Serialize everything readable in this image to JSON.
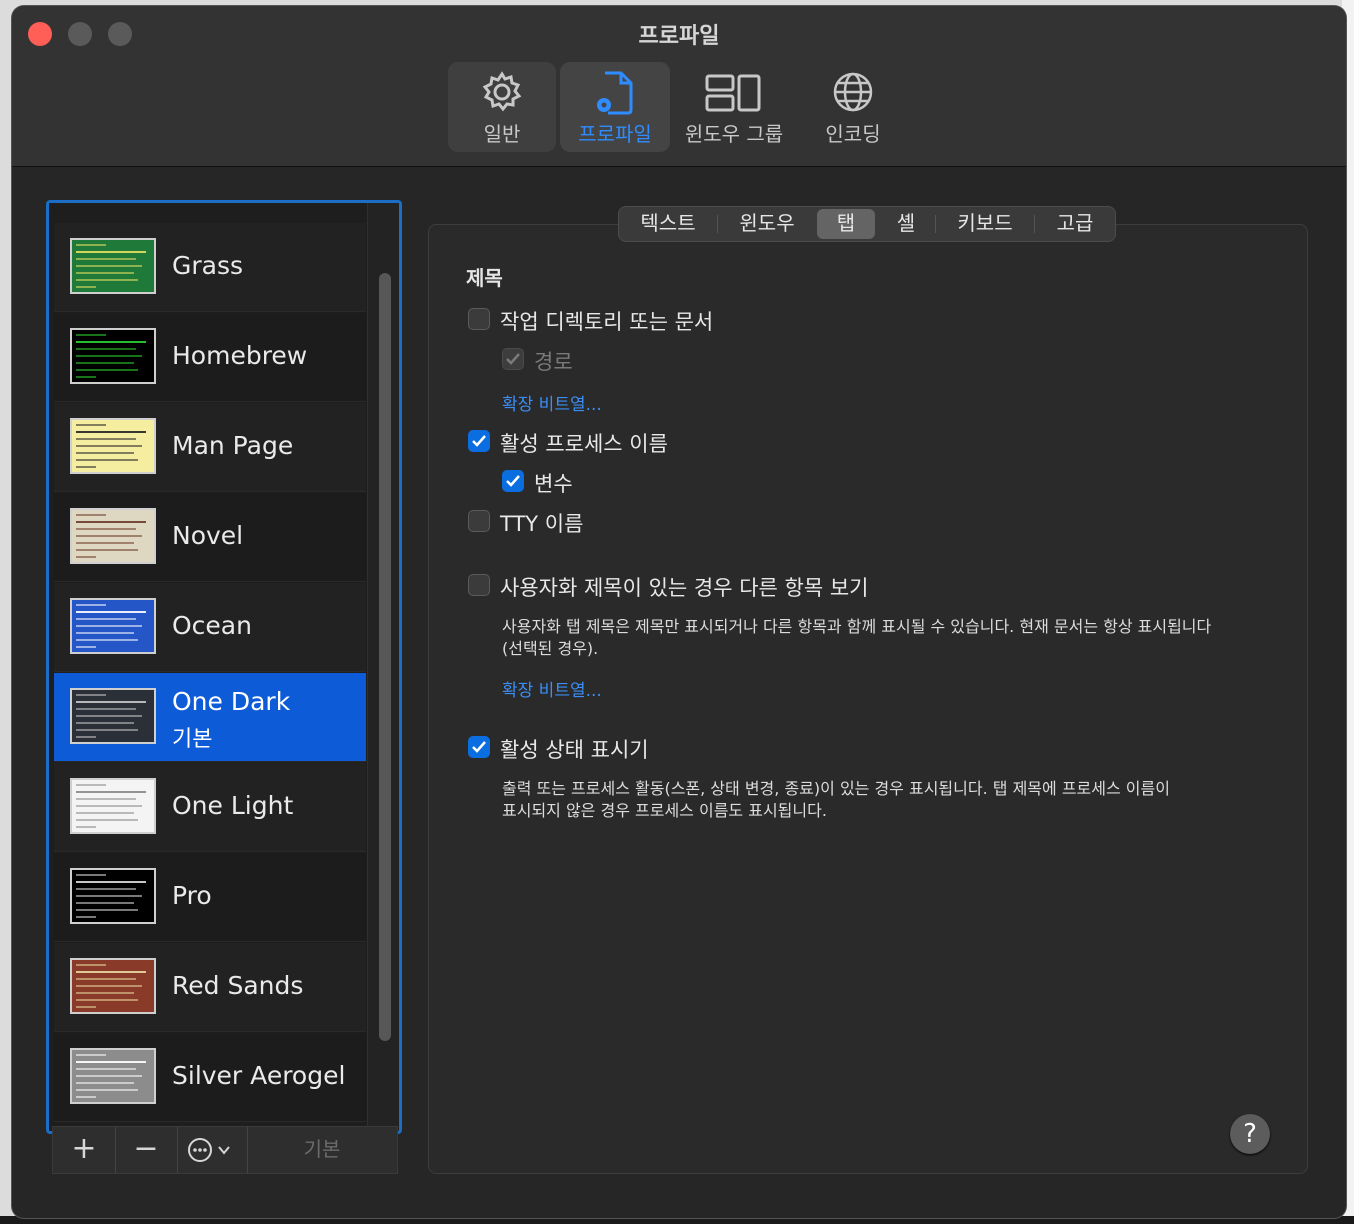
{
  "window": {
    "title": "프로파일"
  },
  "toolbar": {
    "general": "일반",
    "profiles": "프로파일",
    "window_groups": "윈도우 그룹",
    "encoding": "인코딩"
  },
  "profiles": [
    {
      "name": "Grass",
      "thumb_bg": "#1f7a3a",
      "thumb_accent": "#e8e060"
    },
    {
      "name": "Homebrew",
      "thumb_bg": "#000000",
      "thumb_accent": "#2bd42b"
    },
    {
      "name": "Man Page",
      "thumb_bg": "#f5eea0",
      "thumb_accent": "#222222"
    },
    {
      "name": "Novel",
      "thumb_bg": "#ded8c2",
      "thumb_accent": "#6b3b2a"
    },
    {
      "name": "Ocean",
      "thumb_bg": "#2456c8",
      "thumb_accent": "#ffffff"
    },
    {
      "name": "One Dark",
      "subtitle": "기본",
      "thumb_bg": "#2b2f38",
      "thumb_accent": "#c8c8c8",
      "selected": true
    },
    {
      "name": "One Light",
      "thumb_bg": "#f4f4f4",
      "thumb_accent": "#888888"
    },
    {
      "name": "Pro",
      "thumb_bg": "#000000",
      "thumb_accent": "#dddddd"
    },
    {
      "name": "Red Sands",
      "thumb_bg": "#8a3a28",
      "thumb_accent": "#e8d8a0"
    },
    {
      "name": "Silver Aerogel",
      "thumb_bg": "#8c8c8c",
      "thumb_accent": "#ffffff"
    }
  ],
  "list_buttons": {
    "add": "+",
    "remove": "−",
    "more": "⋯⌄",
    "default": "기본"
  },
  "tabs": [
    "텍스트",
    "윈도우",
    "탭",
    "셸",
    "키보드",
    "고급"
  ],
  "active_tab": "탭",
  "section": {
    "title": "제목",
    "working_dir": "작업 디렉토리 또는 문서",
    "path": "경로",
    "ext_link_1": "확장 비트열...",
    "active_process": "활성 프로세스 이름",
    "arguments": "변수",
    "tty": "TTY 이름",
    "custom_title": "사용자화 제목이 있는 경우 다른 항목 보기",
    "custom_desc_1": "사용자화 탭 제목은 제목만 표시되거나 다른 항목과 함께 표시될 수 있습니다. 현재 문서는 항상 표시됩니다",
    "custom_desc_2": "(선택된 경우).",
    "ext_link_2": "확장 비트열...",
    "activity": "활성 상태 표시기",
    "activity_desc_1": "출력 또는 프로세스 활동(스폰, 상태 변경, 종료)이 있는 경우 표시됩니다. 탭 제목에 프로세스 이름이",
    "activity_desc_2": "표시되지 않은 경우 프로세스 이름도 표시됩니다."
  },
  "help": "?",
  "colors": {
    "accent": "#0a6ee0",
    "selection": "#0e5bd8",
    "link": "#3a8ef5"
  }
}
